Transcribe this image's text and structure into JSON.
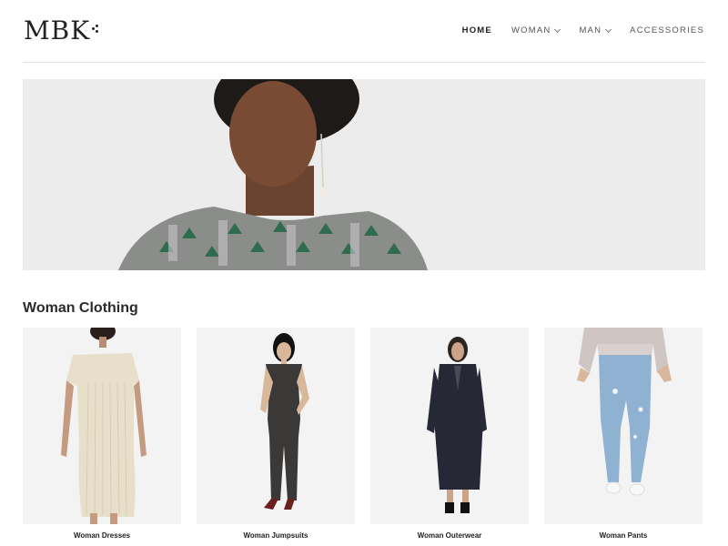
{
  "brand": {
    "logo_text": "MBK"
  },
  "nav": {
    "items": [
      {
        "label": "HOME",
        "active": true,
        "dropdown": false
      },
      {
        "label": "WOMAN",
        "active": false,
        "dropdown": true
      },
      {
        "label": "MAN",
        "active": false,
        "dropdown": true
      },
      {
        "label": "ACCESSORIES",
        "active": false,
        "dropdown": false
      }
    ]
  },
  "hero": {
    "alt": ""
  },
  "section": {
    "title": "Woman Clothing"
  },
  "products": [
    {
      "label": "Woman Dresses"
    },
    {
      "label": "Woman Jumpsuits"
    },
    {
      "label": "Woman Outerwear"
    },
    {
      "label": "Woman Pants"
    }
  ],
  "colors": {
    "background": "#ffffff",
    "hero_bg": "#ececec",
    "product_bg": "#f3f3f3",
    "text": "#222222"
  }
}
